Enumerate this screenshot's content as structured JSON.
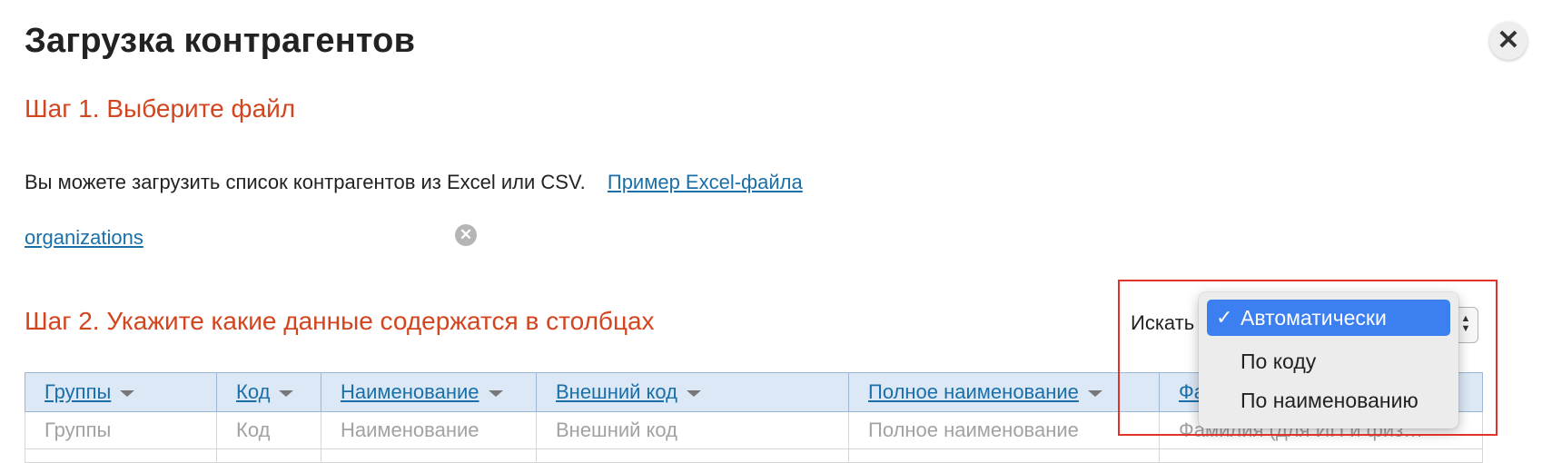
{
  "dialog": {
    "title": "Загрузка контрагентов",
    "close_icon": "close-icon"
  },
  "step1": {
    "heading": "Шаг 1. Выберите файл",
    "info_text": "Вы можете загрузить список контрагентов из Excel или CSV.",
    "example_link": "Пример Excel-файла",
    "file_name": "organizations",
    "remove_icon": "remove-file-icon"
  },
  "step2": {
    "heading": "Шаг 2. Укажите какие данные содержатся в столбцах",
    "search_label": "Искать",
    "dropdown": {
      "options": [
        "Автоматически",
        "По коду",
        "По наименованию"
      ],
      "selected": "Автоматически",
      "check_glyph": "✓"
    }
  },
  "table": {
    "columns": [
      "Группы",
      "Код",
      "Наименование",
      "Внешний код",
      "Полное наименование",
      "Фа"
    ],
    "placeholders": [
      "Группы",
      "Код",
      "Наименование",
      "Внешний код",
      "Полное наименование",
      "Фамилия (для ИП и физ…"
    ]
  },
  "colors": {
    "accent": "#d2451e",
    "link": "#1a6fa8",
    "selected": "#3b7ff0",
    "highlight": "#e0342a"
  }
}
